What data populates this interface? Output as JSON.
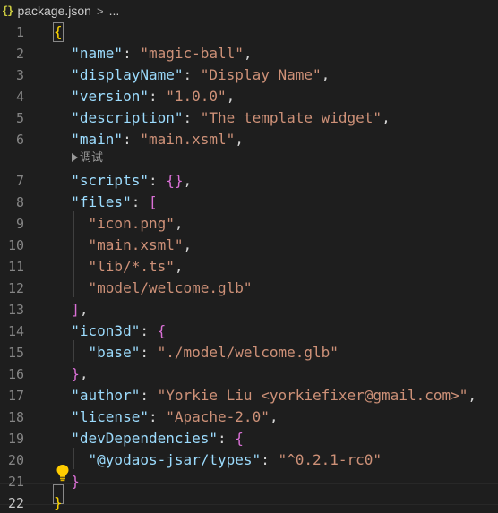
{
  "breadcrumb": {
    "file_icon": "{}",
    "filename": "package.json",
    "chevron": ">",
    "ellipsis": "..."
  },
  "codelens": {
    "label": "调试",
    "icon": "run-icon"
  },
  "lightbulb_icon": "lightbulb-icon",
  "colors": {
    "background": "#1e1e1e",
    "key": "#9cdcfe",
    "string": "#ce9178",
    "punctuation": "#d4d4d4",
    "bracket_level1": "#ffd700",
    "bracket_level2": "#da70d6",
    "line_number": "#858585",
    "lightbulb": "#ffcc00"
  },
  "editor": {
    "active_line": "22",
    "line_numbers": [
      "1",
      "2",
      "3",
      "4",
      "5",
      "6",
      "7",
      "8",
      "9",
      "10",
      "11",
      "12",
      "13",
      "14",
      "15",
      "16",
      "17",
      "18",
      "19",
      "20",
      "21",
      "22"
    ],
    "lines": [
      [
        {
          "t": "{",
          "c": "b1"
        }
      ],
      [
        {
          "t": "  ",
          "c": "p"
        },
        {
          "t": "\"name\"",
          "c": "k"
        },
        {
          "t": ": ",
          "c": "p"
        },
        {
          "t": "\"magic-ball\"",
          "c": "s"
        },
        {
          "t": ",",
          "c": "p"
        }
      ],
      [
        {
          "t": "  ",
          "c": "p"
        },
        {
          "t": "\"displayName\"",
          "c": "k"
        },
        {
          "t": ": ",
          "c": "p"
        },
        {
          "t": "\"Display Name\"",
          "c": "s"
        },
        {
          "t": ",",
          "c": "p"
        }
      ],
      [
        {
          "t": "  ",
          "c": "p"
        },
        {
          "t": "\"version\"",
          "c": "k"
        },
        {
          "t": ": ",
          "c": "p"
        },
        {
          "t": "\"1.0.0\"",
          "c": "s"
        },
        {
          "t": ",",
          "c": "p"
        }
      ],
      [
        {
          "t": "  ",
          "c": "p"
        },
        {
          "t": "\"description\"",
          "c": "k"
        },
        {
          "t": ": ",
          "c": "p"
        },
        {
          "t": "\"The template widget\"",
          "c": "s"
        },
        {
          "t": ",",
          "c": "p"
        }
      ],
      [
        {
          "t": "  ",
          "c": "p"
        },
        {
          "t": "\"main\"",
          "c": "k"
        },
        {
          "t": ": ",
          "c": "p"
        },
        {
          "t": "\"main.xsml\"",
          "c": "s"
        },
        {
          "t": ",",
          "c": "p"
        }
      ],
      [
        {
          "t": "  ",
          "c": "p"
        },
        {
          "t": "\"scripts\"",
          "c": "k"
        },
        {
          "t": ": ",
          "c": "p"
        },
        {
          "t": "{}",
          "c": "b2"
        },
        {
          "t": ",",
          "c": "p"
        }
      ],
      [
        {
          "t": "  ",
          "c": "p"
        },
        {
          "t": "\"files\"",
          "c": "k"
        },
        {
          "t": ": ",
          "c": "p"
        },
        {
          "t": "[",
          "c": "b2"
        }
      ],
      [
        {
          "t": "    ",
          "c": "p"
        },
        {
          "t": "\"icon.png\"",
          "c": "s"
        },
        {
          "t": ",",
          "c": "p"
        }
      ],
      [
        {
          "t": "    ",
          "c": "p"
        },
        {
          "t": "\"main.xsml\"",
          "c": "s"
        },
        {
          "t": ",",
          "c": "p"
        }
      ],
      [
        {
          "t": "    ",
          "c": "p"
        },
        {
          "t": "\"lib/*.ts\"",
          "c": "s"
        },
        {
          "t": ",",
          "c": "p"
        }
      ],
      [
        {
          "t": "    ",
          "c": "p"
        },
        {
          "t": "\"model/welcome.glb\"",
          "c": "s"
        }
      ],
      [
        {
          "t": "  ",
          "c": "p"
        },
        {
          "t": "]",
          "c": "b2"
        },
        {
          "t": ",",
          "c": "p"
        }
      ],
      [
        {
          "t": "  ",
          "c": "p"
        },
        {
          "t": "\"icon3d\"",
          "c": "k"
        },
        {
          "t": ": ",
          "c": "p"
        },
        {
          "t": "{",
          "c": "b2"
        }
      ],
      [
        {
          "t": "    ",
          "c": "p"
        },
        {
          "t": "\"base\"",
          "c": "k"
        },
        {
          "t": ": ",
          "c": "p"
        },
        {
          "t": "\"./model/welcome.glb\"",
          "c": "s"
        }
      ],
      [
        {
          "t": "  ",
          "c": "p"
        },
        {
          "t": "}",
          "c": "b2"
        },
        {
          "t": ",",
          "c": "p"
        }
      ],
      [
        {
          "t": "  ",
          "c": "p"
        },
        {
          "t": "\"author\"",
          "c": "k"
        },
        {
          "t": ": ",
          "c": "p"
        },
        {
          "t": "\"Yorkie Liu <yorkiefixer@gmail.com>\"",
          "c": "s"
        },
        {
          "t": ",",
          "c": "p"
        }
      ],
      [
        {
          "t": "  ",
          "c": "p"
        },
        {
          "t": "\"license\"",
          "c": "k"
        },
        {
          "t": ": ",
          "c": "p"
        },
        {
          "t": "\"Apache-2.0\"",
          "c": "s"
        },
        {
          "t": ",",
          "c": "p"
        }
      ],
      [
        {
          "t": "  ",
          "c": "p"
        },
        {
          "t": "\"devDependencies\"",
          "c": "k"
        },
        {
          "t": ": ",
          "c": "p"
        },
        {
          "t": "{",
          "c": "b2"
        }
      ],
      [
        {
          "t": "    ",
          "c": "p"
        },
        {
          "t": "\"@yodaos-jsar/types\"",
          "c": "k"
        },
        {
          "t": ": ",
          "c": "p"
        },
        {
          "t": "\"^0.2.1-rc0\"",
          "c": "s"
        }
      ],
      [
        {
          "t": "  ",
          "c": "p"
        },
        {
          "t": "}",
          "c": "b2"
        }
      ],
      [
        {
          "t": "}",
          "c": "b1"
        }
      ]
    ]
  }
}
